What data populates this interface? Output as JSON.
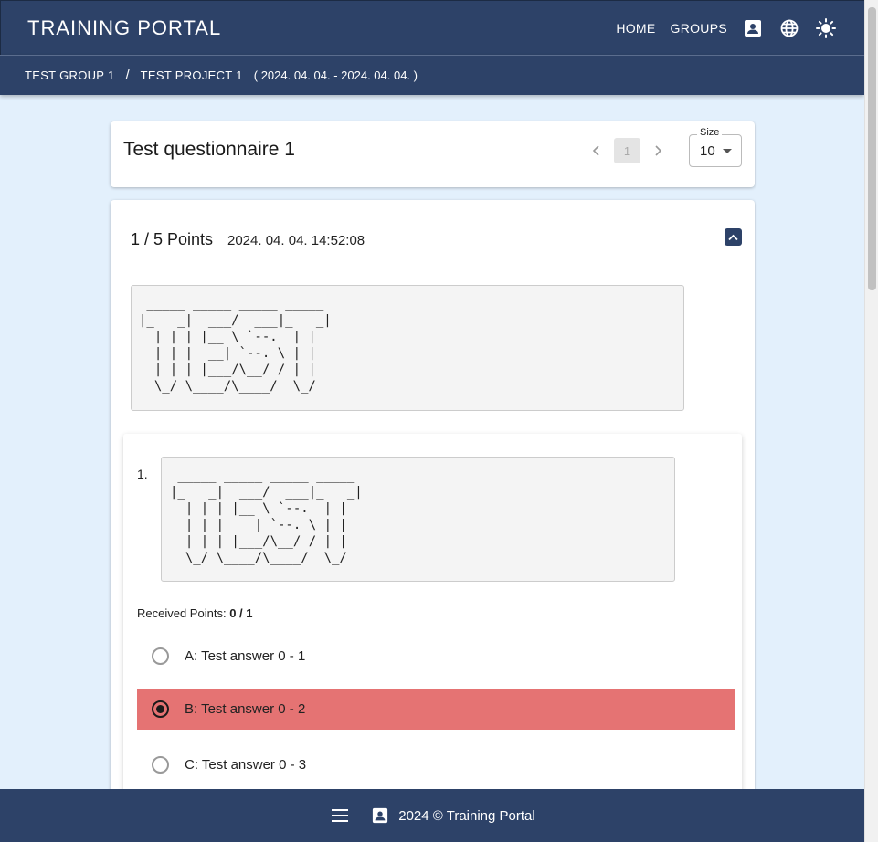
{
  "appbar": {
    "title": "TRAINING PORTAL",
    "nav": [
      {
        "label": "HOME"
      },
      {
        "label": "GROUPS"
      }
    ],
    "icons": [
      "contact-icon",
      "globe-icon",
      "brightness-icon"
    ]
  },
  "breadcrumb": {
    "group": "TEST GROUP 1",
    "separator": "/",
    "project": "TEST PROJECT 1",
    "date_range": "( 2024. 04. 04. - 2024. 04. 04. )"
  },
  "header_card": {
    "title": "Test questionnaire 1",
    "pagination": {
      "current": "1",
      "prev_icon": "chevron-left-icon",
      "next_icon": "chevron-right-icon"
    },
    "size_select": {
      "label": "Size",
      "value": "10"
    }
  },
  "result": {
    "points": "1 / 5 Points",
    "timestamp": "2024. 04. 04. 14:52:08",
    "collapse_icon": "chevron-up-icon",
    "description_ascii": " _____ _____ _____ _____\n|_   _|  ___/  ___|_   _|\n  | | | |__ \\ `--.  | |\n  | | |  __| `--. \\ | |\n  | | | |___/\\__/ / | |\n  \\_/ \\____/\\____/  \\_/"
  },
  "question": {
    "number": "1.",
    "text_ascii": " _____ _____ _____ _____\n|_   _|  ___/  ___|_   _|\n  | | | |__ \\ `--.  | |\n  | | |  __| `--. \\ | |\n  | | | |___/\\__/ / | |\n  \\_/ \\____/\\____/  \\_/",
    "received_label": "Received Points:",
    "received_value": "0 / 1",
    "answers": [
      {
        "label": "A: Test answer 0 - 1",
        "selected": false
      },
      {
        "label": "B: Test answer 0 - 2",
        "selected": true
      },
      {
        "label": "C: Test answer 0 - 3",
        "selected": false
      }
    ]
  },
  "footer": {
    "text": "2024 © Training Portal",
    "icons": [
      "menu-icon",
      "contact-icon"
    ]
  },
  "colors": {
    "primary": "#2d4268",
    "background": "#e3f0fc",
    "wrong_answer": "#e57373"
  }
}
